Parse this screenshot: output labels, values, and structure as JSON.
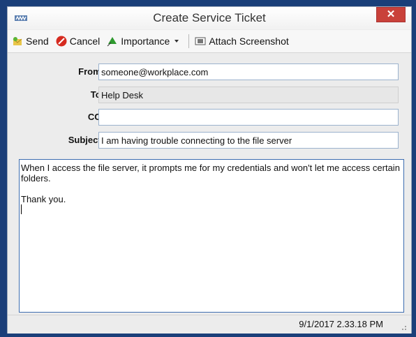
{
  "window": {
    "title": "Create Service Ticket",
    "close_label": "✕"
  },
  "toolbar": {
    "send_label": "Send",
    "cancel_label": "Cancel",
    "importance_label": "Importance",
    "attach_label": "Attach Screenshot"
  },
  "form": {
    "from_label": "From:",
    "from_value": "someone@workplace.com",
    "to_label": "To:",
    "to_value": "Help Desk",
    "cc_label": "CC:",
    "cc_value": "",
    "subject_label": "Subject:",
    "subject_value": "I am having trouble connecting to the file server"
  },
  "body": {
    "paragraph1": "When I access the file server, it prompts me for my credentials and won't let me access certain folders.",
    "paragraph2": "Thank you."
  },
  "status": {
    "timestamp": "9/1/2017 2.33.18 PM"
  },
  "colors": {
    "desktop": "#1b3f79",
    "close_button": "#c9413a",
    "field_border": "#9bb2cd",
    "body_border": "#3d6db0"
  }
}
